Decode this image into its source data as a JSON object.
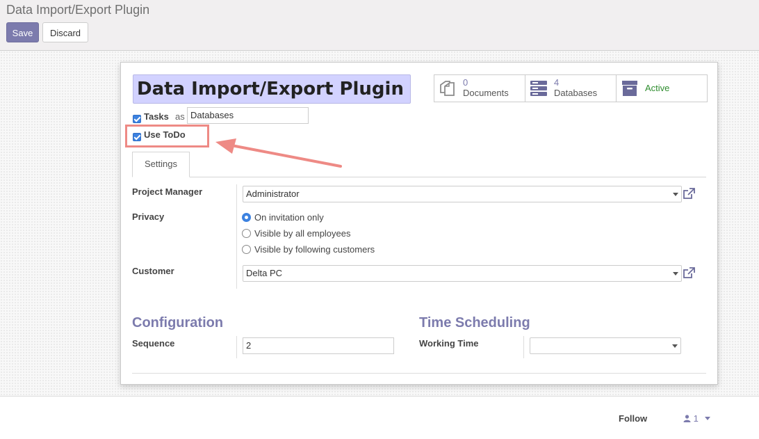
{
  "header": {
    "breadcrumb": "Data Import/Export Plugin",
    "save_label": "Save",
    "discard_label": "Discard"
  },
  "form": {
    "title": "Data Import/Export Plugin",
    "stats": {
      "documents_count": "0",
      "documents_label": "Documents",
      "databases_count": "4",
      "databases_label": "Databases",
      "active_label": "Active"
    },
    "tasks_label": "Tasks",
    "as_label": "as",
    "tasks_alias": "Databases",
    "use_todo_label": "Use ToDo",
    "tab_settings": "Settings",
    "project_manager_label": "Project Manager",
    "project_manager_value": "Administrator",
    "privacy_label": "Privacy",
    "privacy_options": [
      "On invitation only",
      "Visible by all employees",
      "Visible by following customers"
    ],
    "privacy_selected": "On invitation only",
    "customer_label": "Customer",
    "customer_value": "Delta PC",
    "configuration_title": "Configuration",
    "sequence_label": "Sequence",
    "sequence_value": "2",
    "time_scheduling_title": "Time Scheduling",
    "working_time_label": "Working Time",
    "working_time_value": ""
  },
  "chatter": {
    "follow_label": "Follow",
    "followers_count": "1"
  },
  "colors": {
    "accent": "#7c7bad",
    "title_highlight": "#d2d2ff",
    "annotation": "#ee8a85",
    "active_green": "#2f8d2f",
    "checkbox_blue": "#3d82e0"
  }
}
